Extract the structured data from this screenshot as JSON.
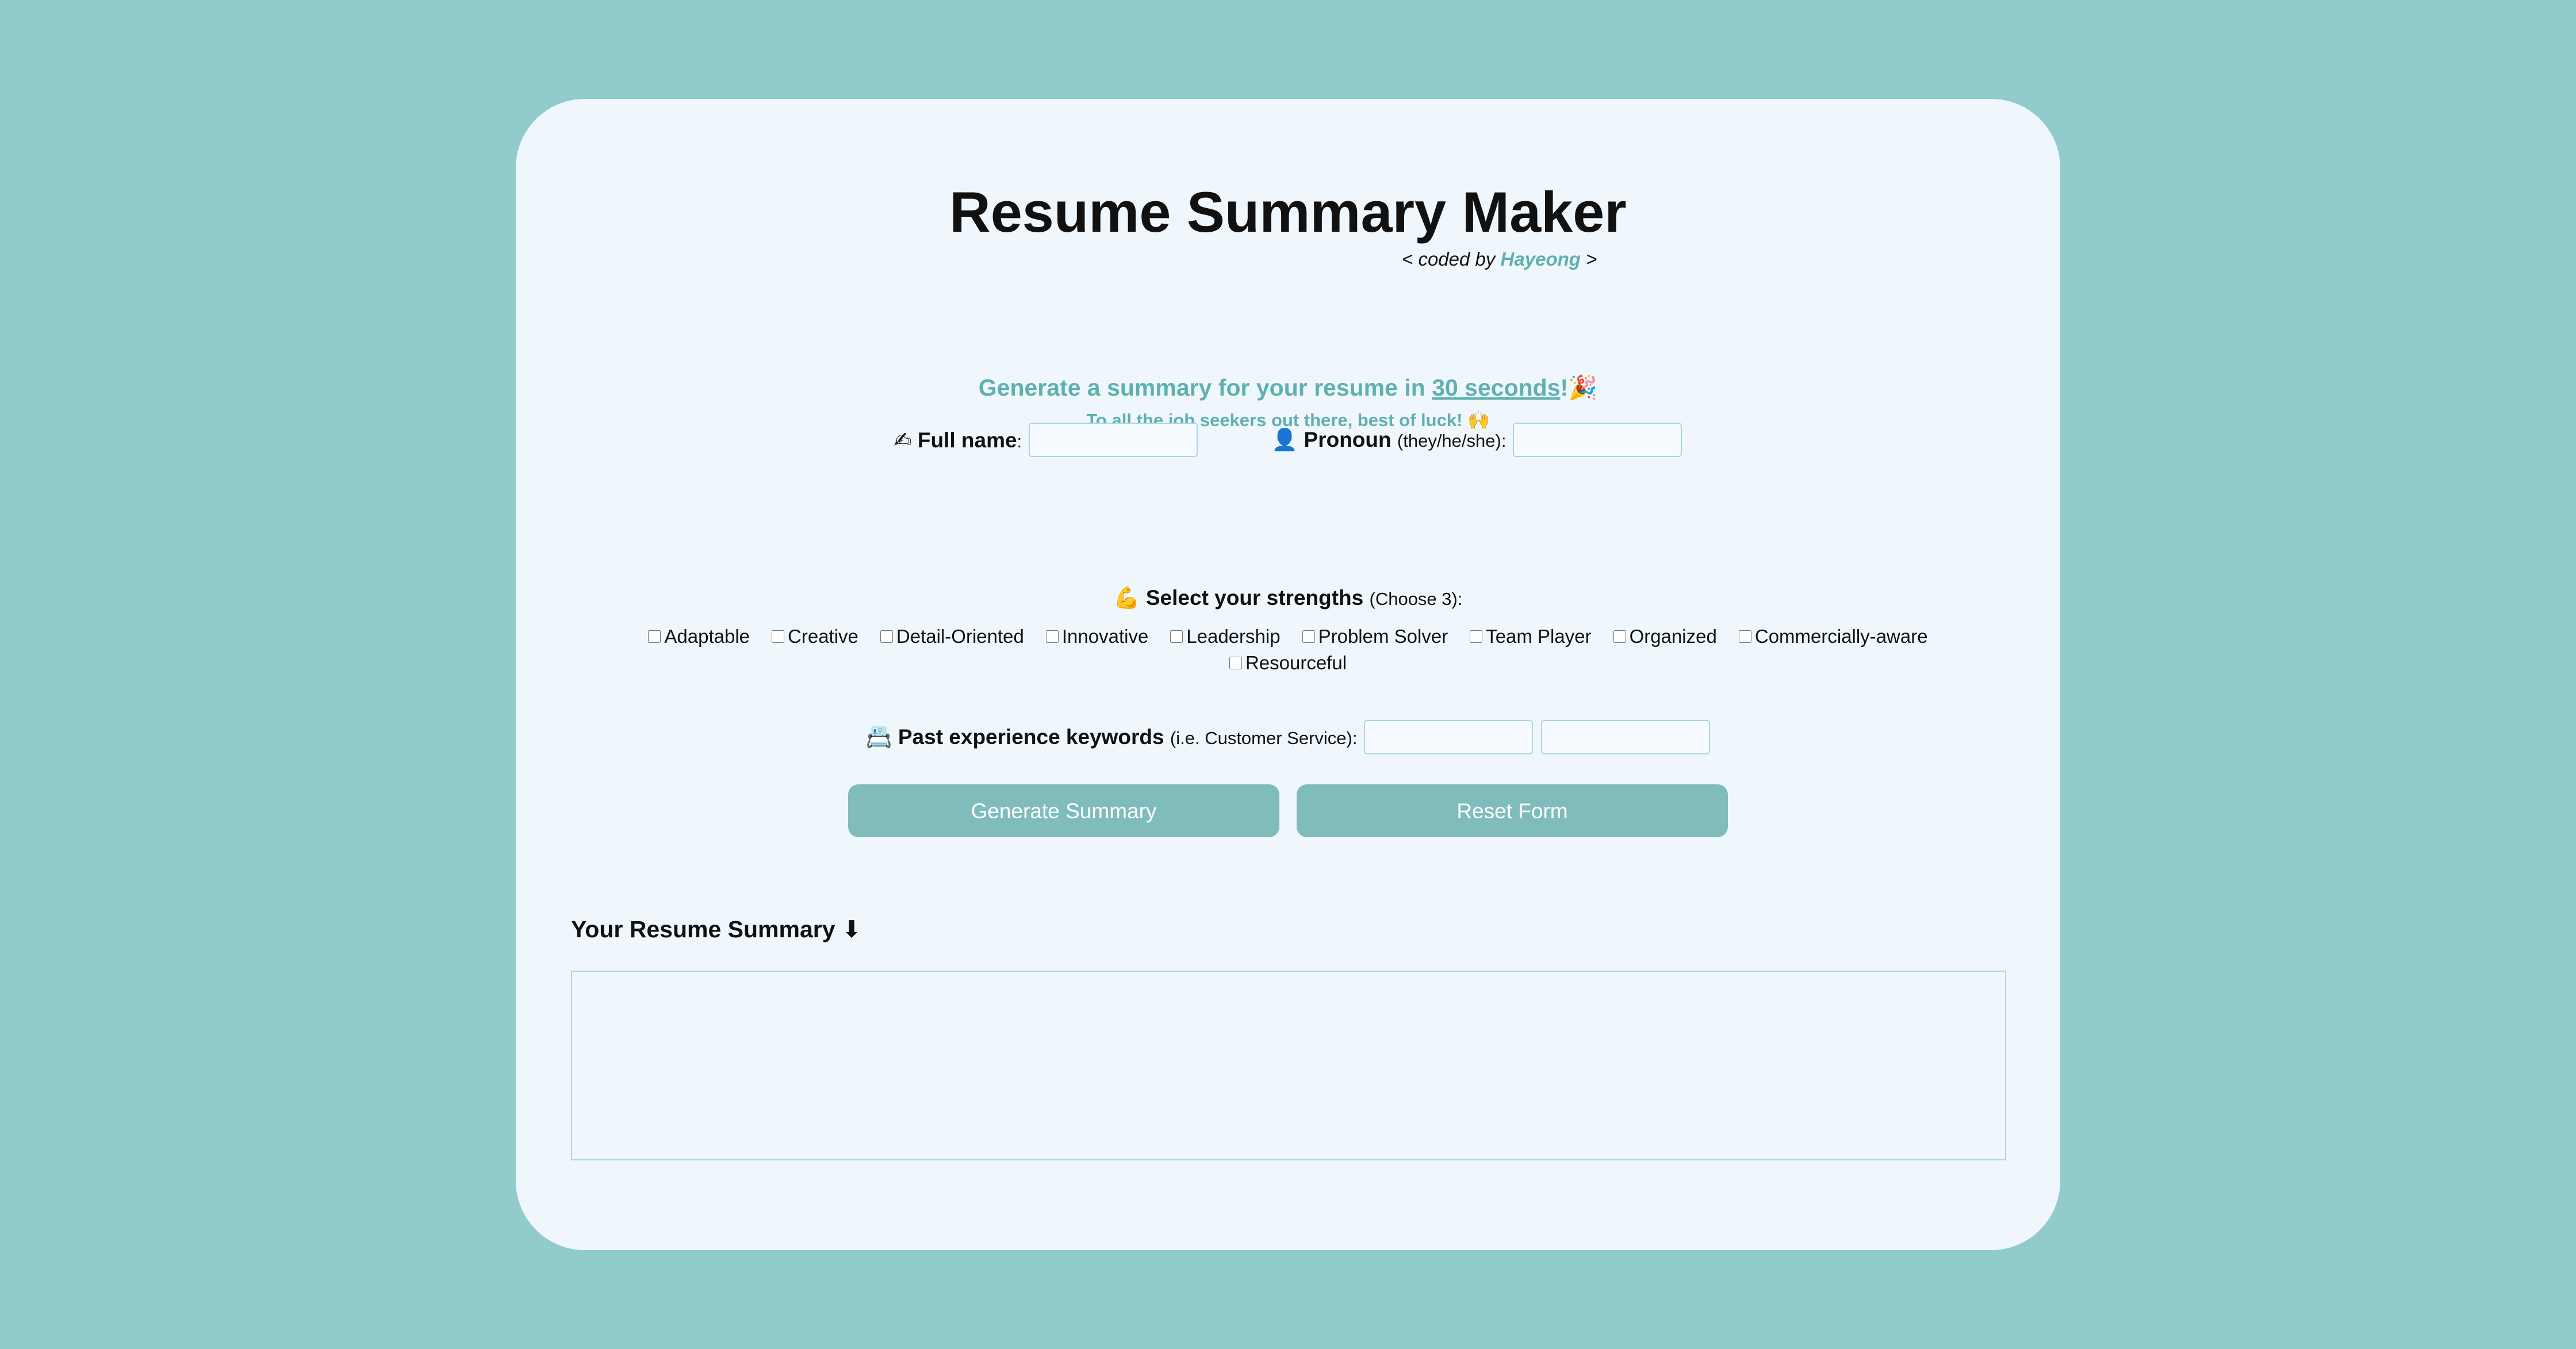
{
  "header": {
    "title": "Resume Summary Maker",
    "byline_prefix": "< coded by",
    "byline_author": "Hayeong",
    "byline_suffix": ">"
  },
  "intro": {
    "tagline_prefix": "Generate a summary for your resume in",
    "tagline_link": "30 seconds",
    "tagline_suffix": "!",
    "tagline_emoji": "🎉",
    "subtag": "To all the job seekers out there, best of luck!",
    "subtag_emoji": "🙌"
  },
  "form": {
    "fullname": {
      "icon": "writing-hand-icon",
      "emoji": "✍",
      "label": "Full name",
      "colon": ":",
      "value": ""
    },
    "pronoun": {
      "icon": "person-silhouette-icon",
      "emoji": "👤",
      "label": "Pronoun",
      "hint": "(they/he/she):",
      "value": ""
    },
    "strengths": {
      "icon": "flexed-bicep-icon",
      "emoji": "💪",
      "label": "Select your strengths",
      "hint": "(Choose 3):",
      "options": [
        {
          "label": "Adaptable",
          "checked": false
        },
        {
          "label": "Creative",
          "checked": false
        },
        {
          "label": "Detail-Oriented",
          "checked": false
        },
        {
          "label": "Innovative",
          "checked": false
        },
        {
          "label": "Leadership",
          "checked": false
        },
        {
          "label": "Problem Solver",
          "checked": false
        },
        {
          "label": "Team Player",
          "checked": false
        },
        {
          "label": "Organized",
          "checked": false
        },
        {
          "label": "Commercially-aware",
          "checked": false
        },
        {
          "label": "Resourceful",
          "checked": false
        }
      ]
    },
    "keywords": {
      "icon": "briefcase-icon",
      "emoji": "📇",
      "label": "Past experience keywords",
      "hint": "(i.e. Customer Service):",
      "value1": "",
      "value2": ""
    },
    "generate_label": "Generate Summary",
    "reset_label": "Reset Form"
  },
  "summary": {
    "heading": "Your Resume Summary",
    "heading_icon": "down-arrow-icon",
    "heading_emoji": "⬇",
    "value": ""
  },
  "colors": {
    "background": "#91cbcb",
    "card": "#eff7fd",
    "accent": "#5fb0b0",
    "button": "#80bcbc",
    "input_border": "#a9d6e3"
  }
}
